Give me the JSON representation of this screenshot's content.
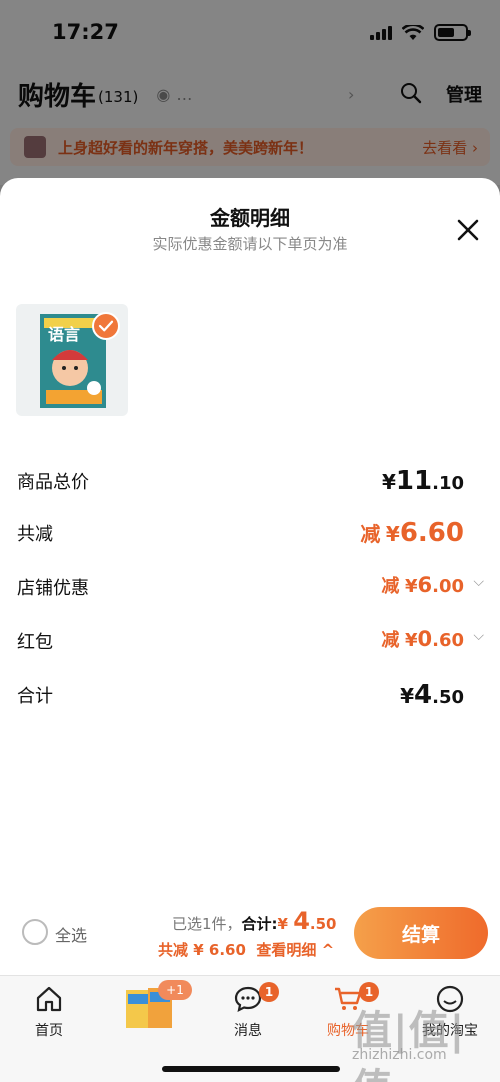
{
  "status": {
    "time": "17:27"
  },
  "header": {
    "title": "购物车",
    "count": "(131)",
    "manage": "管理"
  },
  "promo": {
    "text": "上身超好看的新年穿搭，美美跨新年！",
    "link": "去看看"
  },
  "sheet": {
    "title": "金额明细",
    "subtitle": "实际优惠金额请以下单页为准",
    "product": {
      "cover_text": "语言"
    },
    "rows": {
      "total_price": {
        "label": "商品总价",
        "currency": "¥",
        "int": "11",
        "dec": ".10"
      },
      "total_reduce": {
        "label": "共减",
        "prefix": "减",
        "currency": "¥",
        "value": "6.60"
      },
      "shop_discount": {
        "label": "店铺优惠",
        "prefix": "减",
        "currency": "¥",
        "int": "6",
        "dec": ".00"
      },
      "red_packet": {
        "label": "红包",
        "prefix": "减",
        "currency": "¥",
        "int": "0",
        "dec": ".60"
      },
      "sum": {
        "label": "合计",
        "currency": "¥",
        "int": "4",
        "dec": ".50"
      }
    }
  },
  "checkout": {
    "select_all": "全选",
    "selected": "已选1件，",
    "total_label": "合计:",
    "total_currency": "¥",
    "total_int": "4",
    "total_dec": ".50",
    "reduce": "共减 ¥ 6.60",
    "detail": "查看明细 ^",
    "pay": "结算"
  },
  "tabbar": {
    "items": [
      {
        "label": "首页"
      },
      {
        "label": ""
      },
      {
        "label": "消息",
        "badge": "1"
      },
      {
        "label": "购物车",
        "badge": "1"
      },
      {
        "label": "我的淘宝"
      }
    ],
    "promo_badge": "+1"
  },
  "watermark": {
    "big": "值|值|值",
    "small": "zhizhizhi.com"
  },
  "colors": {
    "accent": "#e8632a",
    "pay_start": "#f5a04a",
    "pay_end": "#ef6a2b"
  }
}
